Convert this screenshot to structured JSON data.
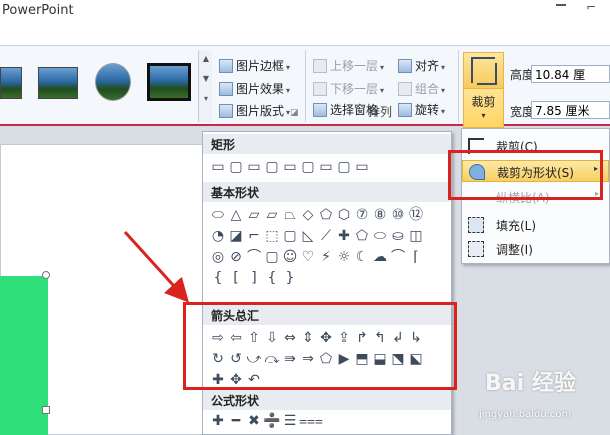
{
  "window": {
    "title": "PowerPoint",
    "maximize_glyph": "⌐"
  },
  "ribbon": {
    "picture_styles": {
      "scroll_up": "▲",
      "scroll_down": "▼",
      "more": "▾"
    },
    "picture_commands": [
      {
        "label": "图片边框",
        "icon": "border-icon"
      },
      {
        "label": "图片效果",
        "icon": "effects-icon"
      },
      {
        "label": "图片版式",
        "icon": "layout-icon"
      }
    ],
    "arrange": {
      "group_label": "排列",
      "bring_forward": "上移一层",
      "send_backward": "下移一层",
      "selection_pane": "选择窗格",
      "align": "对齐",
      "group": "组合",
      "rotate": "旋转"
    },
    "crop": {
      "label": "裁剪",
      "arrow": "▾"
    },
    "size": {
      "height_label": "高度:",
      "height_value": "10.84 厘",
      "width_label": "宽度:",
      "width_value": "7.85 厘米"
    }
  },
  "crop_menu": {
    "items": [
      {
        "label": "裁剪(C)",
        "icon": "crop-icon",
        "disabled": false,
        "submenu": false
      },
      {
        "label": "裁剪为形状(S)",
        "icon": "crop-to-shape-icon",
        "disabled": false,
        "submenu": true,
        "highlighted": true
      },
      {
        "label": "纵横比(A)",
        "icon": "",
        "disabled": true,
        "submenu": true
      },
      {
        "label": "填充(L)",
        "icon": "fill-icon",
        "disabled": false,
        "submenu": false
      },
      {
        "label": "调整(I)",
        "icon": "fit-icon",
        "disabled": false,
        "submenu": false
      }
    ],
    "submenu_arrow": "▸"
  },
  "shape_gallery": {
    "categories": [
      "矩形",
      "基本形状",
      "箭头总汇",
      "公式形状"
    ],
    "rectangles": [
      "▭",
      "▢",
      "▭",
      "▢",
      "▭",
      "▢",
      "▭",
      "▢",
      "▭"
    ],
    "basic_shapes": [
      [
        "⬭",
        "△",
        "▱",
        "▱",
        "⏢",
        "◇",
        "⬠",
        "⬡",
        "⑦",
        "⑧",
        "⑩",
        "⑫"
      ],
      [
        "◔",
        "◪",
        "⌐",
        "⬚",
        "▢",
        "◺",
        "⟋",
        "✚",
        "⬠",
        "⬭",
        "⛀",
        "◫"
      ],
      [
        "◎",
        "⊘",
        "⌒",
        "▢",
        "☺",
        "♡",
        "⚡",
        "☼",
        "☾",
        "☁",
        "⌒",
        "⌈"
      ],
      [
        "{",
        "[",
        "]",
        "{",
        "}"
      ]
    ],
    "arrows": [
      [
        "⇨",
        "⇦",
        "⇧",
        "⇩",
        "⇔",
        "⇕",
        "✥",
        "⇪",
        "↱",
        "↰",
        "↲",
        "↳"
      ],
      [
        "↻",
        "↺",
        "⤻",
        "⤼",
        "⇛",
        "⇒",
        "⬠",
        "▶",
        "⬒",
        "⬓",
        "⬔",
        "⬕"
      ],
      [
        "✚",
        "✥",
        "↶"
      ]
    ],
    "equation": [
      "✚",
      "━",
      "✖",
      "➗",
      "☰",
      "⩶"
    ]
  },
  "watermark": {
    "logo": "Bai 经验",
    "url": "jingyan.baidu.com"
  },
  "colors": {
    "highlight_red": "#d9231f",
    "shape_green": "#2fe07a",
    "ribbon_rule": "#c62a4a"
  }
}
